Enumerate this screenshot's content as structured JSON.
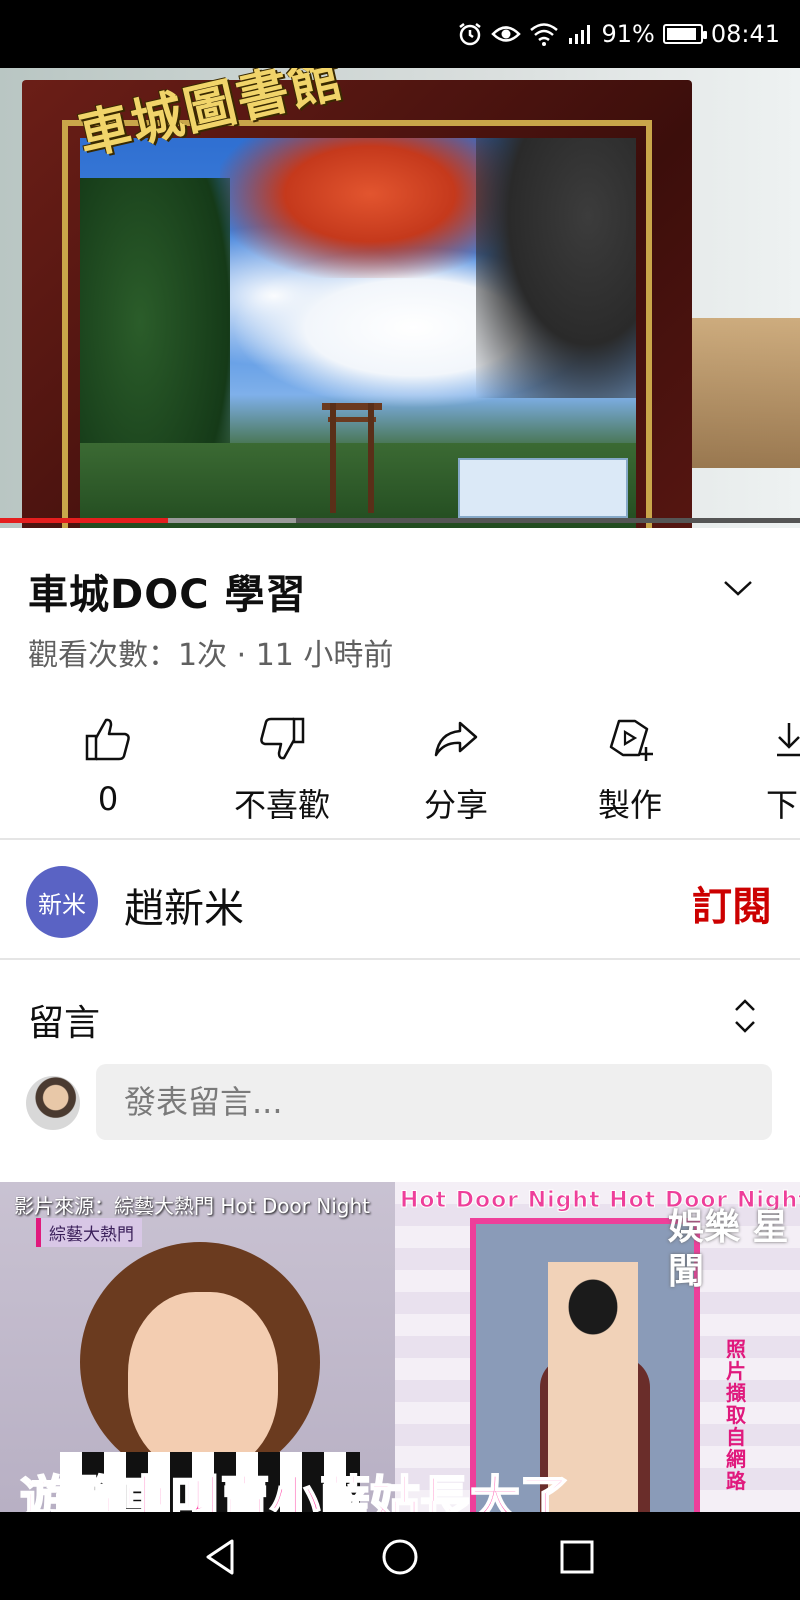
{
  "status_bar": {
    "battery_text": "91%",
    "battery_level": 0.91,
    "time": "08:41",
    "icons": [
      "alarm-icon",
      "eye-icon",
      "wifi-icon",
      "signal-icon",
      "battery-icon"
    ]
  },
  "video": {
    "overlay_title": "車城圖書館",
    "progress_played": 0.21,
    "progress_buffered": 0.37
  },
  "info": {
    "title": "車城DOC  學習",
    "meta": "觀看次數：1次 · 11 小時前"
  },
  "actions": {
    "like_count": "0",
    "dislike_label": "不喜歡",
    "share_label": "分享",
    "create_label": "製作",
    "download_label": "下"
  },
  "channel": {
    "avatar_text": "新米",
    "name": "趙新米",
    "subscribe_label": "訂閱",
    "avatar_color": "#5a63c4",
    "subscribe_color": "#cc0000"
  },
  "comments": {
    "title": "留言",
    "input_placeholder": "發表留言..."
  },
  "next_video": {
    "source_text": "影片來源：綜藝大熱門 Hot Door Night",
    "badge": "綜藝大熱門",
    "banner": "Hot Door Night Hot Door Night",
    "brand": "娛樂 星聞",
    "vertical_note": "照片擷取自網路",
    "caption": "遊覽車叫賣小薩姑長大了"
  },
  "nav": {
    "icons": [
      "back-icon",
      "home-icon",
      "recents-icon"
    ]
  }
}
